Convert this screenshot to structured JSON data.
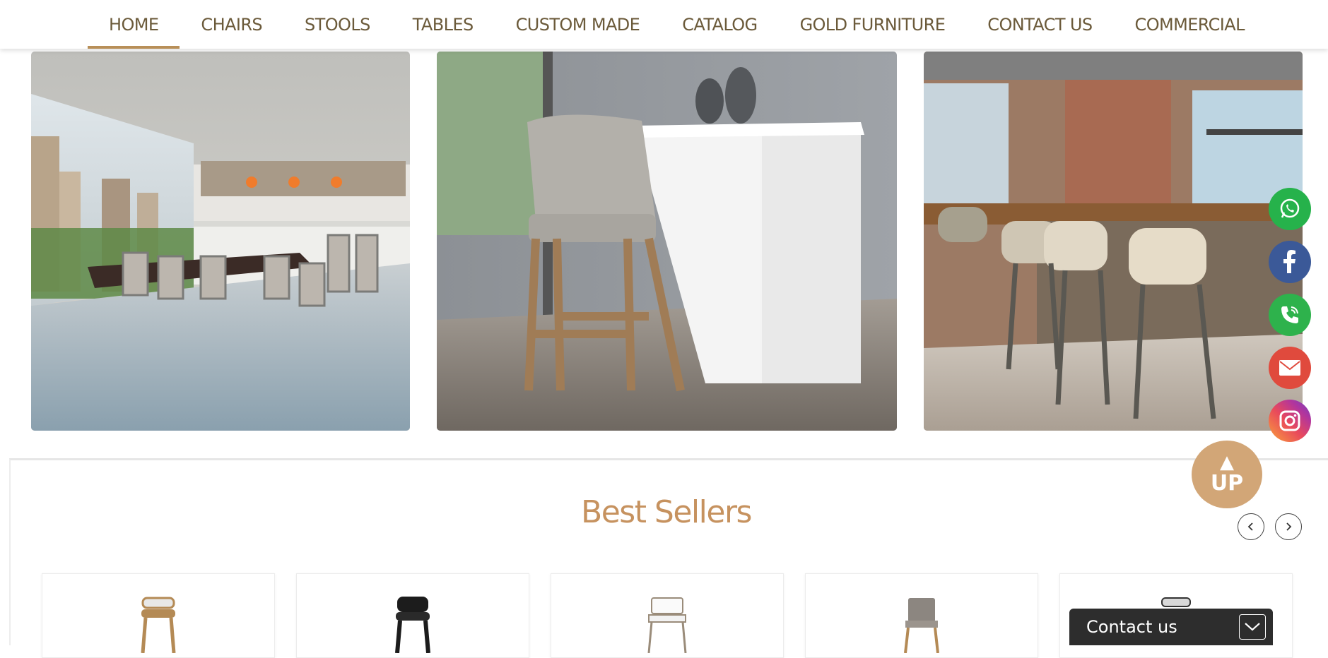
{
  "nav": {
    "items": [
      {
        "label": "HOME",
        "active": true
      },
      {
        "label": "CHAIRS"
      },
      {
        "label": "STOOLS"
      },
      {
        "label": "TABLES"
      },
      {
        "label": "CUSTOM MADE"
      },
      {
        "label": "CATALOG"
      },
      {
        "label": "GOLD FURNITURE"
      },
      {
        "label": "CONTACT US"
      },
      {
        "label": "COMMERCIAL"
      }
    ]
  },
  "best_sellers": {
    "title": "Best Sellers"
  },
  "floating": {
    "up_label": "UP",
    "contact_label": "Contact us",
    "social": [
      "whatsapp-icon",
      "facebook-icon",
      "phone-icon",
      "email-icon",
      "instagram-icon"
    ]
  },
  "colors": {
    "accent": "#c6925f",
    "nav_text": "#6b5a3a",
    "active_underline": "#b88f58"
  }
}
